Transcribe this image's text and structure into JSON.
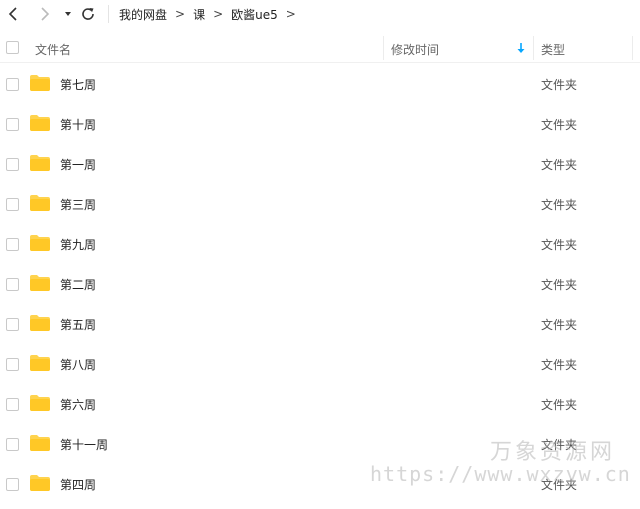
{
  "toolbar": {
    "back_icon": "chevron-left-icon",
    "forward_icon": "chevron-right-icon",
    "dropdown_icon": "caret-down-icon",
    "refresh_icon": "refresh-icon",
    "breadcrumb": [
      "我的网盘",
      "课",
      "欧酱ue5"
    ],
    "breadcrumb_separator": ">"
  },
  "header": {
    "name_col": "文件名",
    "modified_col": "修改时间",
    "type_col": "类型",
    "sort_icon": "arrow-down-icon",
    "accent_color": "#06a7ff"
  },
  "rows": [
    {
      "name": "第七周",
      "type": "文件夹"
    },
    {
      "name": "第十周",
      "type": "文件夹"
    },
    {
      "name": "第一周",
      "type": "文件夹"
    },
    {
      "name": "第三周",
      "type": "文件夹"
    },
    {
      "name": "第九周",
      "type": "文件夹"
    },
    {
      "name": "第二周",
      "type": "文件夹"
    },
    {
      "name": "第五周",
      "type": "文件夹"
    },
    {
      "name": "第八周",
      "type": "文件夹"
    },
    {
      "name": "第六周",
      "type": "文件夹"
    },
    {
      "name": "第十一周",
      "type": "文件夹"
    },
    {
      "name": "第四周",
      "type": "文件夹"
    }
  ],
  "folder_color": "#ffd34d",
  "watermark": {
    "title": "万象资源网",
    "url": "https://www.wxzyw.cn"
  }
}
